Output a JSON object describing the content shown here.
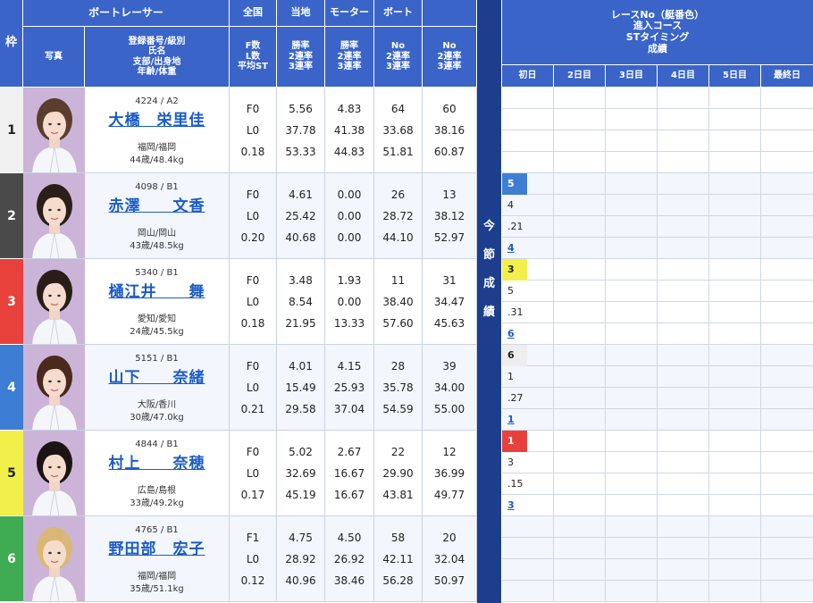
{
  "header": {
    "waku": "枠",
    "boatracer": "ボートレーサー",
    "photo": "写真",
    "info_lines": [
      "登録番号/級別",
      "氏名",
      "支部/出身地",
      "年齢/体重"
    ],
    "fl_lines": [
      "F数",
      "L数",
      "平均ST"
    ],
    "zenkoku": "全国",
    "touchi": "当地",
    "motor": "モーター",
    "boat": "ボート",
    "rate_lines": [
      "勝率",
      "2連率",
      "3連率"
    ],
    "no_lines": [
      "No",
      "2連率",
      "3連率"
    ],
    "race_lines": [
      "レースNo（艇番色）",
      "進入コース",
      "STタイミング",
      "成績"
    ],
    "days": [
      "初日",
      "2日目",
      "3日目",
      "4日目",
      "5日目",
      "最終日"
    ]
  },
  "vertical_label": [
    "今",
    "節",
    "成",
    "績"
  ],
  "colors": {
    "header_bg": "#3a64c8",
    "vertical_bar": "#1d3e8c",
    "waku": [
      "#f0f0f0",
      "#4a4a4a",
      "#e8413b",
      "#3d7ed4",
      "#f3ef4a",
      "#3fab52"
    ],
    "waku_text": [
      "#222222",
      "#ffffff",
      "#ffffff",
      "#ffffff",
      "#222222",
      "#ffffff"
    ]
  },
  "racers": [
    {
      "waku": "1",
      "reg": "4224 / A2",
      "name": "大橋　栄里佳",
      "branch": "福岡/福岡",
      "age": "44歳/48.4kg",
      "f": "F0",
      "l": "L0",
      "st": "0.18",
      "zenkoku": [
        "5.56",
        "37.78",
        "53.33"
      ],
      "touchi": [
        "4.83",
        "41.38",
        "44.83"
      ],
      "motor": [
        "64",
        "33.68",
        "51.81"
      ],
      "boat": [
        "60",
        "38.16",
        "60.87"
      ],
      "race": null
    },
    {
      "waku": "2",
      "reg": "4098 / B1",
      "name": "赤澤　　文香",
      "branch": "岡山/岡山",
      "age": "43歳/48.5kg",
      "f": "F0",
      "l": "L0",
      "st": "0.20",
      "zenkoku": [
        "4.61",
        "25.42",
        "40.68"
      ],
      "touchi": [
        "0.00",
        "0.00",
        "0.00"
      ],
      "motor": [
        "26",
        "28.72",
        "44.10"
      ],
      "boat": [
        "13",
        "38.12",
        "52.97"
      ],
      "race": {
        "no": "5",
        "course": "4",
        "st": ".21",
        "result": "4",
        "color": "#3d7ed4",
        "text": "#ffffff"
      }
    },
    {
      "waku": "3",
      "reg": "5340 / B1",
      "name": "樋江井　　舞",
      "branch": "愛知/愛知",
      "age": "24歳/45.5kg",
      "f": "F0",
      "l": "L0",
      "st": "0.18",
      "zenkoku": [
        "3.48",
        "8.54",
        "21.95"
      ],
      "touchi": [
        "1.93",
        "0.00",
        "13.33"
      ],
      "motor": [
        "11",
        "38.40",
        "57.60"
      ],
      "boat": [
        "31",
        "34.47",
        "45.63"
      ],
      "race": {
        "no": "3",
        "course": "5",
        "st": ".31",
        "result": "6",
        "color": "#f3ef4a",
        "text": "#222222"
      }
    },
    {
      "waku": "4",
      "reg": "5151 / B1",
      "name": "山下　　奈緒",
      "branch": "大阪/香川",
      "age": "30歳/47.0kg",
      "f": "F0",
      "l": "L0",
      "st": "0.21",
      "zenkoku": [
        "4.01",
        "15.49",
        "29.58"
      ],
      "touchi": [
        "4.15",
        "25.93",
        "37.04"
      ],
      "motor": [
        "28",
        "35.78",
        "54.59"
      ],
      "boat": [
        "39",
        "34.00",
        "55.00"
      ],
      "race": {
        "no": "6",
        "course": "1",
        "st": ".27",
        "result": "1",
        "color": "#eeeeee",
        "text": "#222222"
      }
    },
    {
      "waku": "5",
      "reg": "4844 / B1",
      "name": "村上　　奈穂",
      "branch": "広島/島根",
      "age": "33歳/49.2kg",
      "f": "F0",
      "l": "L0",
      "st": "0.17",
      "zenkoku": [
        "5.02",
        "32.69",
        "45.19"
      ],
      "touchi": [
        "2.67",
        "16.67",
        "16.67"
      ],
      "motor": [
        "22",
        "29.90",
        "43.81"
      ],
      "boat": [
        "12",
        "36.99",
        "49.77"
      ],
      "race": {
        "no": "1",
        "course": "3",
        "st": ".15",
        "result": "3",
        "color": "#e8413b",
        "text": "#ffffff"
      }
    },
    {
      "waku": "6",
      "reg": "4765 / B1",
      "name": "野田部　宏子",
      "branch": "福岡/福岡",
      "age": "35歳/51.1kg",
      "f": "F1",
      "l": "L0",
      "st": "0.12",
      "zenkoku": [
        "4.75",
        "28.92",
        "40.96"
      ],
      "touchi": [
        "4.50",
        "26.92",
        "38.46"
      ],
      "motor": [
        "58",
        "42.11",
        "56.28"
      ],
      "boat": [
        "20",
        "32.04",
        "50.97"
      ],
      "race": null
    }
  ]
}
